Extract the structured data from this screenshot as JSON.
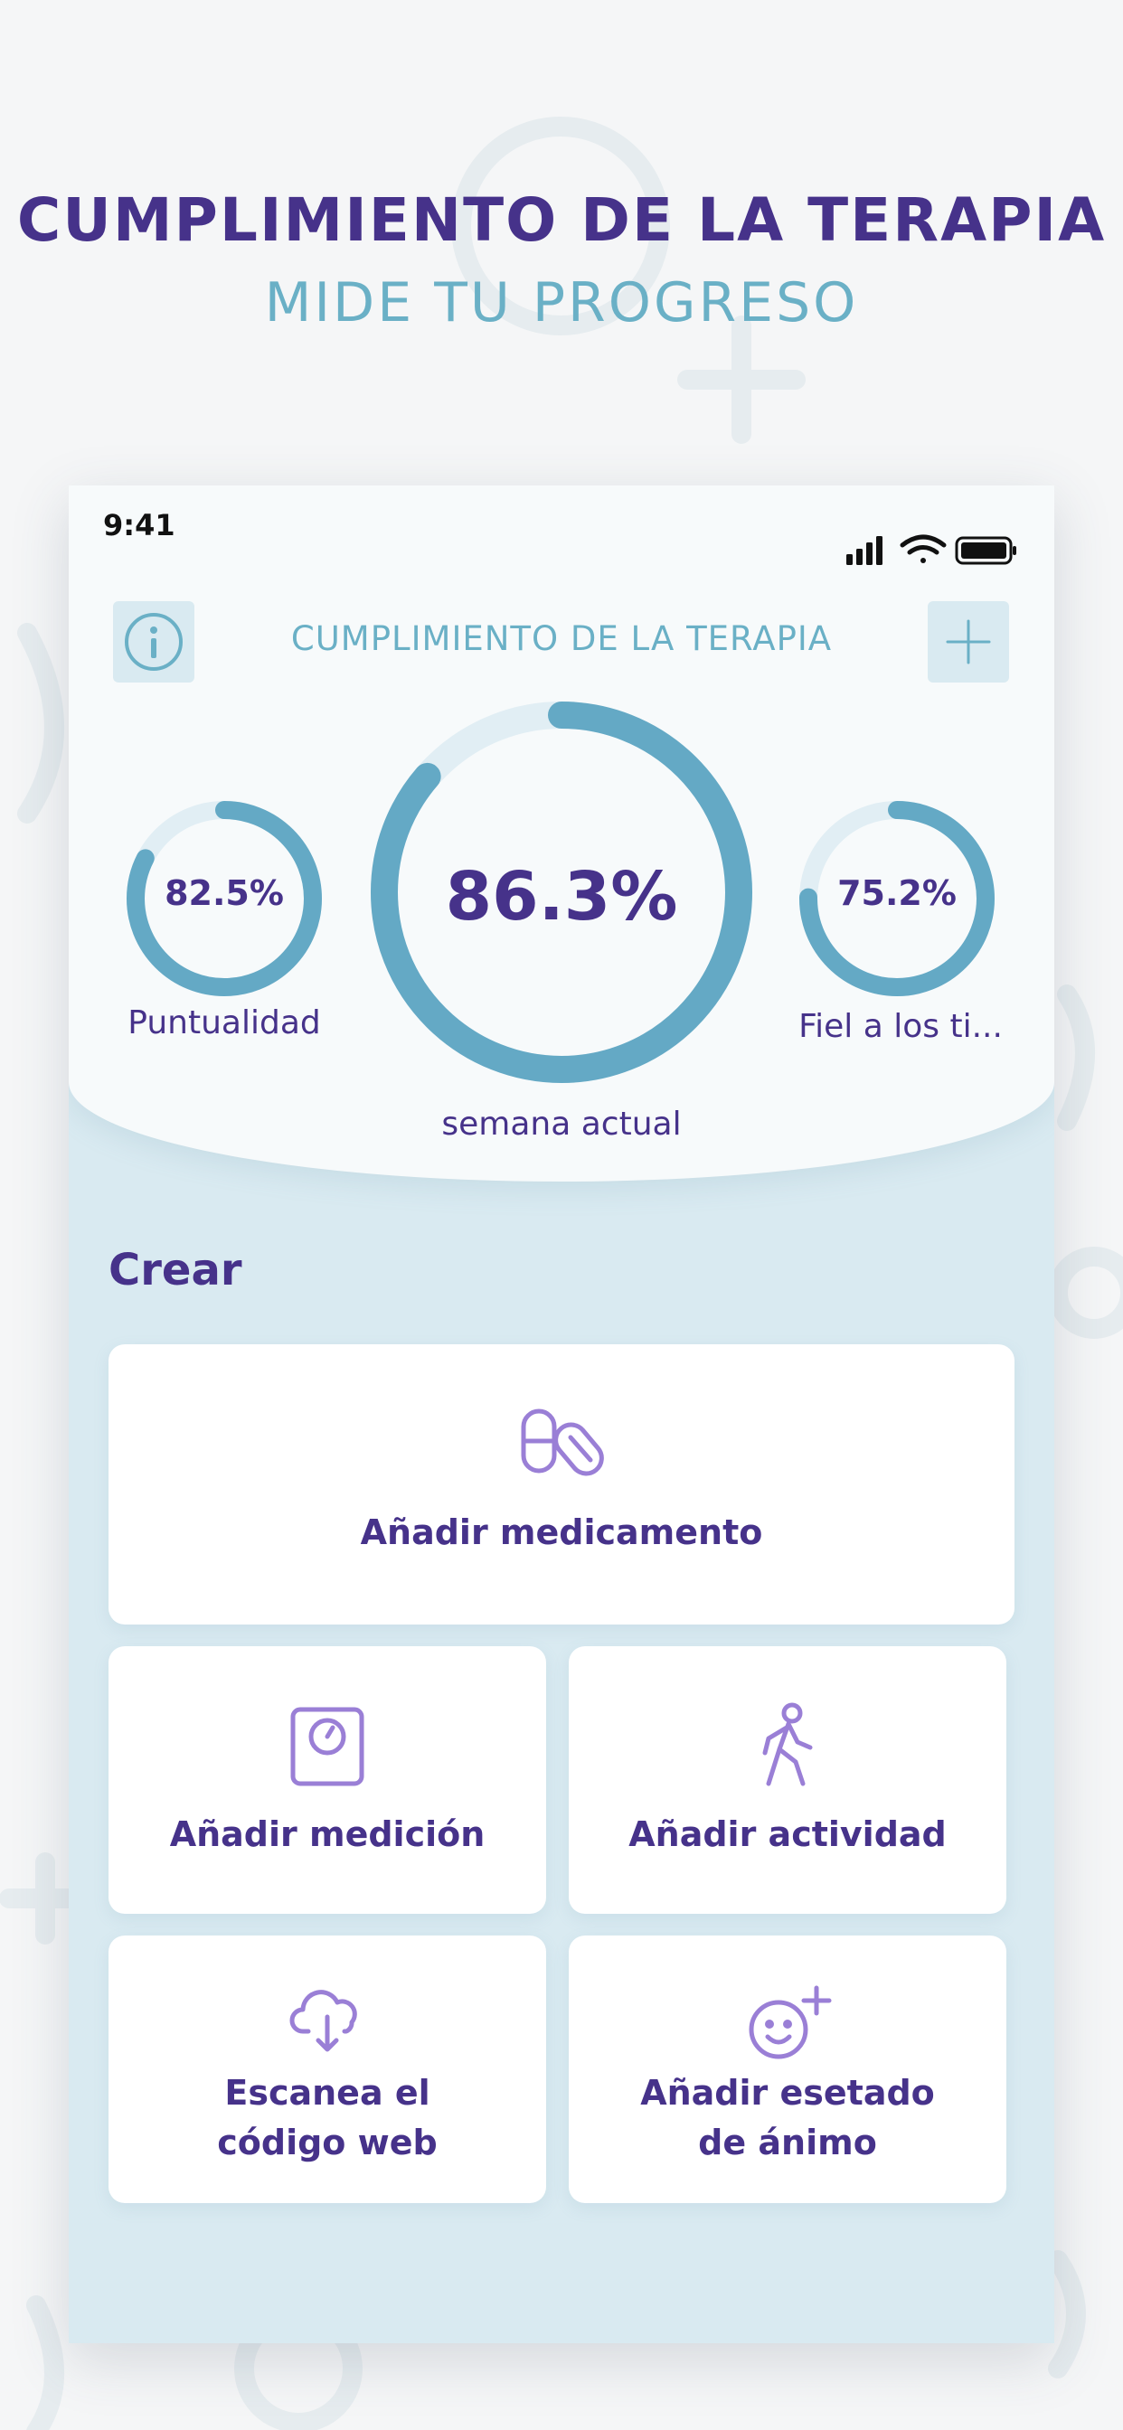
{
  "promo": {
    "title": "CUMPLIMIENTO DE LA TERAPIA",
    "subtitle": "MIDE TU PROGRESO"
  },
  "status_bar": {
    "time": "9:41",
    "icons": [
      "signal-icon",
      "wifi-icon",
      "battery-icon"
    ]
  },
  "header": {
    "title": "CUMPLIMIENTO DE LA TERAPIA",
    "info_icon": "info-icon",
    "add_icon": "plus-icon"
  },
  "stats": {
    "main": {
      "value": "86.3%",
      "percent": 86.3,
      "label": "semana actual"
    },
    "left": {
      "value": "82.5%",
      "percent": 82.5,
      "label": "Puntualidad"
    },
    "right": {
      "value": "75.2%",
      "percent": 75.2,
      "label": "Fiel a los ti..."
    }
  },
  "create": {
    "title": "Crear",
    "actions": [
      {
        "label": "Añadir medicamento",
        "icon": "pills-icon"
      },
      {
        "label": "Añadir medición",
        "icon": "scale-icon"
      },
      {
        "label": "Añadir actividad",
        "icon": "walking-icon"
      },
      {
        "label_line1": "Escanea el",
        "label_line2": "código web",
        "icon": "cloud-download-icon"
      },
      {
        "label_line1": "Añadir esetado",
        "label_line2": "de ánimo",
        "icon": "smiley-plus-icon"
      }
    ]
  },
  "colors": {
    "accent_purple": "#46328a",
    "accent_teal": "#6ab0c6",
    "ring_track": "#e1eef4",
    "icon_purple": "#9a7fd6",
    "panel_bg": "#d9eaf1"
  }
}
